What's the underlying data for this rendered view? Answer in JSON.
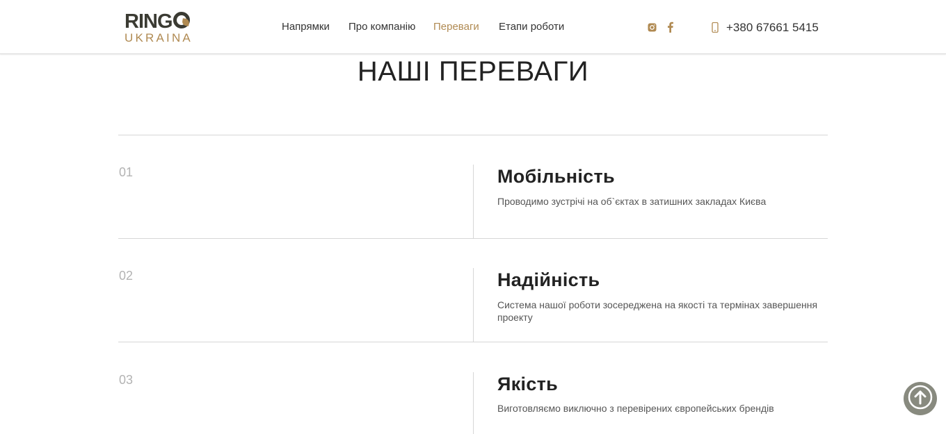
{
  "header": {
    "logo": {
      "top_text": "RING",
      "bottom_text": "UKRAINA"
    },
    "nav": [
      {
        "label": "Напрямки",
        "active": false
      },
      {
        "label": "Про компанію",
        "active": false
      },
      {
        "label": "Переваги",
        "active": true
      },
      {
        "label": "Етапи роботи",
        "active": false
      }
    ],
    "social": [
      {
        "icon": "instagram-icon"
      },
      {
        "icon": "facebook-icon"
      }
    ],
    "phone": {
      "icon": "phone-icon",
      "number": "+380 67661 5415"
    }
  },
  "section": {
    "title": "НАШІ ПЕРЕВАГИ",
    "items": [
      {
        "number": "01",
        "title": "Мобільність",
        "text": "Проводимо зустрічі на об`єктах в затишних закладах Києва"
      },
      {
        "number": "02",
        "title": "Надійність",
        "text": "Система нашої роботи зосереджена на якості та термінах завершення проекту"
      },
      {
        "number": "03",
        "title": "Якість",
        "text": "Виготовляємо виключно з перевірених європейських брендів"
      }
    ]
  },
  "scroll_top": {
    "icon": "arrow-up-icon"
  },
  "colors": {
    "accent": "#b08a52",
    "text_dark": "#222222",
    "divider": "#d6d6d6",
    "scroll_button": "#888a7f"
  }
}
